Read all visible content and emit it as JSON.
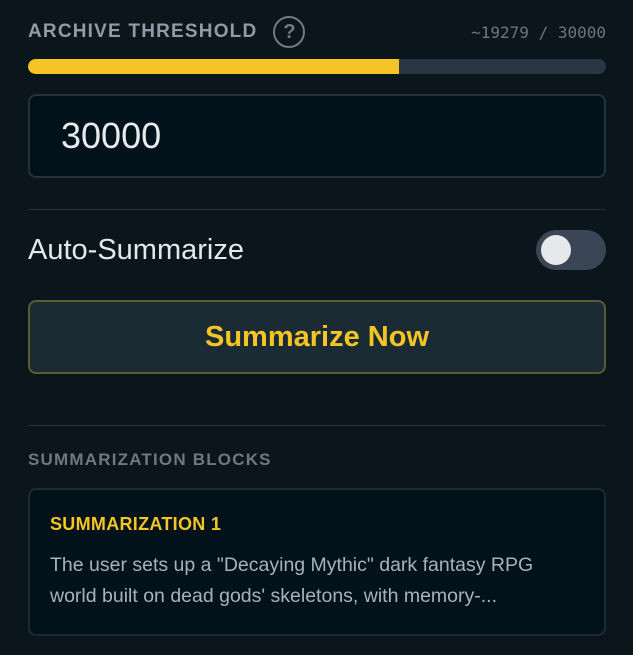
{
  "threshold": {
    "title": "ARCHIVE THRESHOLD",
    "help_symbol": "?",
    "token_count": "~19279 / 30000",
    "progress_fraction": 0.6426,
    "value": "30000"
  },
  "auto_summarize": {
    "label": "Auto-Summarize",
    "enabled": false
  },
  "actions": {
    "summarize_now_label": "Summarize Now"
  },
  "blocks": {
    "section_title": "SUMMARIZATION BLOCKS",
    "items": [
      {
        "title": "SUMMARIZATION 1",
        "preview": "The user sets up a \"Decaying Mythic\" dark fantasy RPG world built on dead gods' skeletons, with memory-..."
      }
    ]
  },
  "colors": {
    "accent": "#f5c526",
    "background": "#0b151c",
    "track": "#2b3645"
  },
  "icons": {
    "help": "help-circle-icon"
  }
}
